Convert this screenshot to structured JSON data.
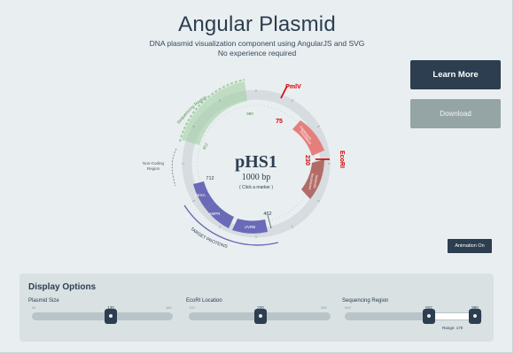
{
  "header": {
    "title": "Angular Plasmid",
    "subtitle_line1": "DNA plasmid visualization component using AngularJS and SVG",
    "subtitle_line2": "No experience required"
  },
  "buttons": {
    "learn_more": "Learn More",
    "download": "Download",
    "animation": "Animation On"
  },
  "plasmid": {
    "name": "pHS1",
    "size_label": "1000 bp",
    "hint": "( Click a marker )",
    "features": {
      "sequencing_region": "Sequencing Region",
      "non_coding_line1": "Non-Coding",
      "non_coding_line2": "Region",
      "kanamycin_line1": "Kanamycin",
      "kanamycin_line2": "Resistance",
      "antibiotic_line1": "Antibiotic",
      "antibiotic_line2": "Resistance",
      "target_proteins": "TARGET PROTEINS",
      "lexa": "LEXA",
      "ampr": "AMPR",
      "uvrb": "UVRB"
    },
    "enzymes": {
      "pmlv": "PmlV",
      "ecori": "EcoRI"
    },
    "position_labels": {
      "p75": "75",
      "p230": "230",
      "p462": "462",
      "p712": "712",
      "p980": "980",
      "p822": "822"
    },
    "colors": {
      "backbone": "#d6dcdf",
      "sequencing": "#9fcf9f",
      "kanamycin": "#e57f7c",
      "antibiotic": "#b26b67",
      "target": "#6a6ab8",
      "enzyme": "#d40000",
      "dark": "#2c3e50"
    }
  },
  "options": {
    "title": "Display Options",
    "plasmid_size": {
      "label": "Plasmid Size",
      "min": "90",
      "max": "180",
      "value": "130"
    },
    "ecori_location": {
      "label": "EcoRI Location",
      "min": "100",
      "max": "350",
      "value": "230"
    },
    "sequencing_region": {
      "label": "Sequencing Region",
      "min": "900",
      "low": "822",
      "high": "980",
      "range_text": "Range: 170"
    }
  }
}
